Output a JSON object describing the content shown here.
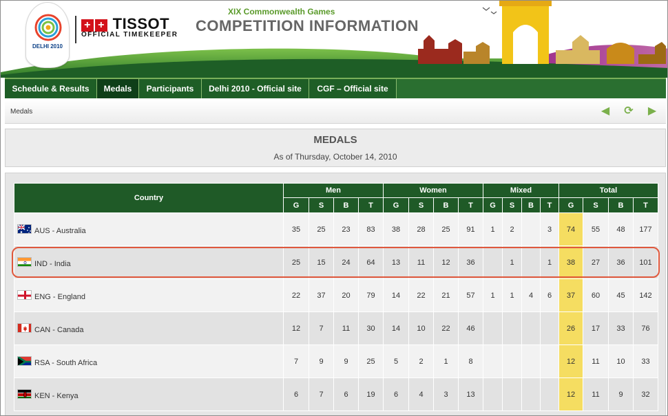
{
  "header": {
    "logo_text": "DELHI 2010",
    "brand": "TISSOT",
    "brand_sub": "OFFICIAL TIMEKEEPER",
    "event_sub": "XIX Commonwealth Games",
    "event_title": "COMPETITION INFORMATION"
  },
  "nav": {
    "items": [
      {
        "label": "Schedule & Results"
      },
      {
        "label": "Medals"
      },
      {
        "label": "Participants"
      },
      {
        "label": "Delhi 2010 - Official site"
      },
      {
        "label": "CGF – Official site"
      }
    ],
    "active": "Medals"
  },
  "breadcrumb": {
    "text": "Medals"
  },
  "page": {
    "title": "MEDALS",
    "subtitle": "As of Thursday, October 14, 2010"
  },
  "table": {
    "country_header": "Country",
    "groups": [
      "Men",
      "Women",
      "Mixed",
      "Total"
    ],
    "sub": [
      "G",
      "S",
      "B",
      "T"
    ],
    "rows": [
      {
        "country": "AUS - Australia",
        "flag": "aus-flag",
        "cells": [
          "35",
          "25",
          "23",
          "83",
          "38",
          "28",
          "25",
          "91",
          "1",
          "2",
          "",
          "3",
          "74",
          "55",
          "48",
          "177"
        ]
      },
      {
        "country": "IND - India",
        "flag": "ind-flag",
        "cells": [
          "25",
          "15",
          "24",
          "64",
          "13",
          "11",
          "12",
          "36",
          "",
          "1",
          "",
          "1",
          "38",
          "27",
          "36",
          "101"
        ]
      },
      {
        "country": "ENG - England",
        "flag": "eng-flag",
        "cells": [
          "22",
          "37",
          "20",
          "79",
          "14",
          "22",
          "21",
          "57",
          "1",
          "1",
          "4",
          "6",
          "37",
          "60",
          "45",
          "142"
        ]
      },
      {
        "country": "CAN - Canada",
        "flag": "can-flag",
        "cells": [
          "12",
          "7",
          "11",
          "30",
          "14",
          "10",
          "22",
          "46",
          "",
          "",
          "",
          "",
          "26",
          "17",
          "33",
          "76"
        ]
      },
      {
        "country": "RSA - South Africa",
        "flag": "rsa-flag",
        "cells": [
          "7",
          "9",
          "9",
          "25",
          "5",
          "2",
          "1",
          "8",
          "",
          "",
          "",
          "",
          "12",
          "11",
          "10",
          "33"
        ]
      },
      {
        "country": "KEN - Kenya",
        "flag": "ken-flag",
        "cells": [
          "6",
          "7",
          "6",
          "19",
          "6",
          "4",
          "3",
          "13",
          "",
          "",
          "",
          "",
          "12",
          "11",
          "9",
          "32"
        ]
      }
    ]
  },
  "colors": {
    "nav_green": "#1e5e26",
    "header_green": "#1f5a27",
    "gold_highlight": "#f5dd61",
    "selection_outline": "#e0583c"
  }
}
